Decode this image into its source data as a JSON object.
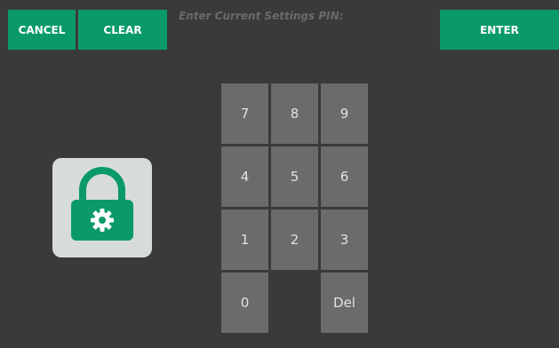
{
  "toolbar": {
    "cancel_label": "CANCEL",
    "clear_label": "CLEAR",
    "enter_label": "ENTER"
  },
  "pin": {
    "prompt": "Enter Current Settings PIN:",
    "value": ""
  },
  "keypad": {
    "keys": [
      "7",
      "8",
      "9",
      "4",
      "5",
      "6",
      "1",
      "2",
      "3",
      "0",
      "Del"
    ]
  },
  "icons": {
    "lock": "lock-gear-icon"
  },
  "colors": {
    "accent": "#0a9a6a",
    "background": "#3a3a3a",
    "key": "#6b6b6b",
    "tile": "#d7dcd9"
  }
}
